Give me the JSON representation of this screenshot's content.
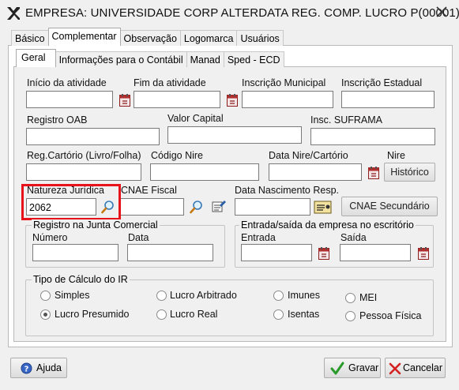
{
  "window": {
    "title": "EMPRESA: UNIVERSIDADE CORP ALTERDATA REG. COMP. LUCRO P(00001)"
  },
  "tabs_main": [
    "Básico",
    "Complementar",
    "Observação",
    "Logomarca",
    "Usuários"
  ],
  "tabs_sub": [
    "Geral",
    "Informações para o Contábil",
    "Manad",
    "Sped - ECD"
  ],
  "fields": {
    "inicio_atividade": {
      "label": "Início da atividade",
      "value": ""
    },
    "fim_atividade": {
      "label": "Fim da atividade",
      "value": ""
    },
    "inscricao_municipal": {
      "label": "Inscrição Municipal",
      "value": ""
    },
    "inscricao_estadual": {
      "label": "Inscrição Estadual",
      "value": ""
    },
    "registro_oab": {
      "label": "Registro OAB",
      "value": ""
    },
    "valor_capital": {
      "label": "Valor Capital",
      "value": ""
    },
    "insc_suframa": {
      "label": "Insc. SUFRAMA",
      "value": ""
    },
    "reg_cartorio": {
      "label": "Reg.Cartório (Livro/Folha)",
      "value": ""
    },
    "codigo_nire": {
      "label": "Código Nire",
      "value": ""
    },
    "data_nire": {
      "label": "Data Nire/Cartório",
      "value": ""
    },
    "nire_label": "Nire",
    "natureza_juridica": {
      "label": "Natureza Jurídica",
      "value": "2062"
    },
    "cnae_fiscal": {
      "label": "CNAE Fiscal",
      "value": ""
    },
    "data_nascimento": {
      "label": "Data Nascimento Resp.",
      "value": ""
    }
  },
  "buttons": {
    "historico": "Histórico",
    "cnae_secundario": "CNAE Secundário",
    "ajuda": "Ajuda",
    "gravar": "Gravar",
    "cancelar": "Cancelar"
  },
  "junta": {
    "title": "Registro na Junta Comercial",
    "numero_label": "Número",
    "data_label": "Data",
    "numero_value": "",
    "data_value": ""
  },
  "entrada_saida": {
    "title": "Entrada/saída da empresa no escritório",
    "entrada_label": "Entrada",
    "saida_label": "Saída",
    "entrada_value": "",
    "saida_value": ""
  },
  "calculo_ir": {
    "title": "Tipo de Cálculo do IR",
    "options": [
      "Simples",
      "Lucro Arbitrado",
      "Imunes",
      "MEI",
      "Lucro Presumido",
      "Lucro Real",
      "Isentas",
      "Pessoa Física"
    ],
    "selected": "Lucro Presumido"
  },
  "colors": {
    "highlight": "#e8121b",
    "title_text": "#111111"
  }
}
